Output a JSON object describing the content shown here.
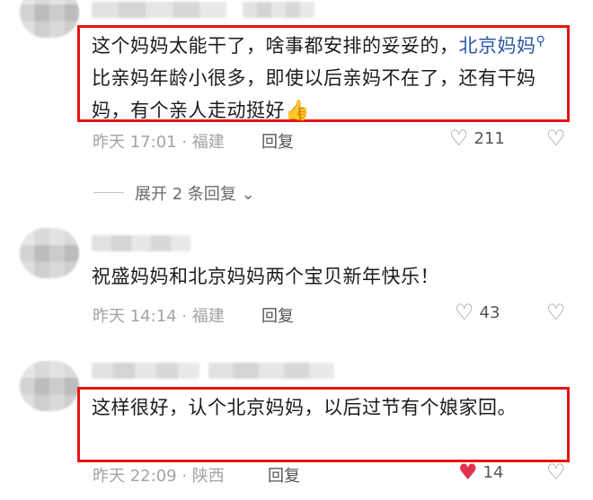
{
  "comments": [
    {
      "text_before": "这个妈妈太能干了，啥事都安排的妥妥的，",
      "link": "北京妈妈",
      "text_after": "比亲妈年龄小很多，即使以后亲妈不在了，还有干妈妈，有个亲人走动挺好",
      "emoji": "👍",
      "time": "昨天 17:01",
      "location": "福建",
      "reply_label": "回复",
      "likes": "211",
      "liked": false
    },
    {
      "text": "祝盛妈妈和北京妈妈两个宝贝新年快乐！",
      "time": "昨天 14:14",
      "location": "福建",
      "reply_label": "回复",
      "likes": "43",
      "liked": false
    },
    {
      "text": "这样很好，认个北京妈妈，以后过节有个娘家回。",
      "time": "昨天 22:09",
      "location": "陕西",
      "reply_label": "回复",
      "likes": "14",
      "liked": true
    }
  ],
  "expand_replies": "展开 2 条回复",
  "icons": {
    "heart": "heart-icon",
    "dislike": "broken-heart-icon",
    "search": "search-icon",
    "chevron": "chevron-down-icon"
  },
  "colors": {
    "highlight_border": "#e41613",
    "link": "#2a58a6",
    "liked_heart": "#e2324f"
  }
}
